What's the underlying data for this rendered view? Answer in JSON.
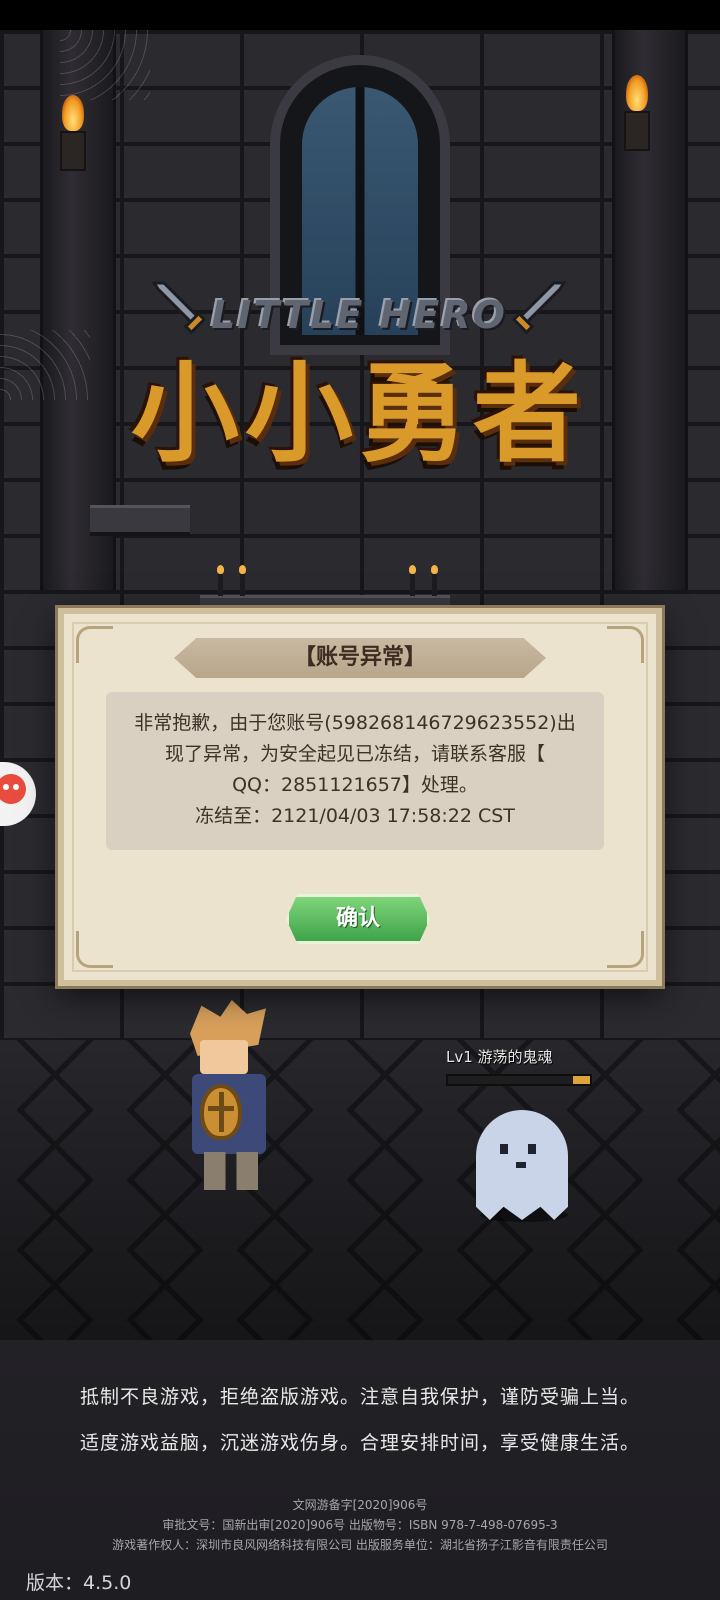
{
  "game": {
    "logo_en": "LITTLE HERO",
    "logo_cn": "小小勇者"
  },
  "dialog": {
    "title": "【账号异常】",
    "message_lines": [
      "非常抱歉，由于您账号(598268146729623552)出",
      "现了异常，为安全起见已冻结，请联系客服【",
      "QQ：2851121657】处理。",
      "冻结至：2121/04/03 17:58:22 CST"
    ],
    "confirm_label": "确认"
  },
  "enemy": {
    "label": "Lv1 游荡的鬼魂",
    "hp_fraction": 0.12,
    "hp_color": "#e0a23b"
  },
  "footer": {
    "notice_line1": "抵制不良游戏，拒绝盗版游戏。注意自我保护，谨防受骗上当。",
    "notice_line2": "适度游戏益脑，沉迷游戏伤身。合理安排时间，享受健康生活。",
    "legal_line1": "文网游备字[2020]906号",
    "legal_line2": "审批文号：国新出审[2020]906号  出版物号：ISBN 978-7-498-07695-3",
    "legal_line3": "游戏著作权人：深圳市良风网络科技有限公司  出版服务单位：湖北省扬子江影音有限责任公司",
    "version": "版本：4.5.0"
  },
  "icons": {
    "side_float": "assistant-float-icon",
    "logo_swords": "crossed-sword-icon"
  },
  "colors": {
    "confirm_button": "#4cae52",
    "dialog_background": "#ece3cf",
    "logo_gold": "#d99a2a"
  }
}
